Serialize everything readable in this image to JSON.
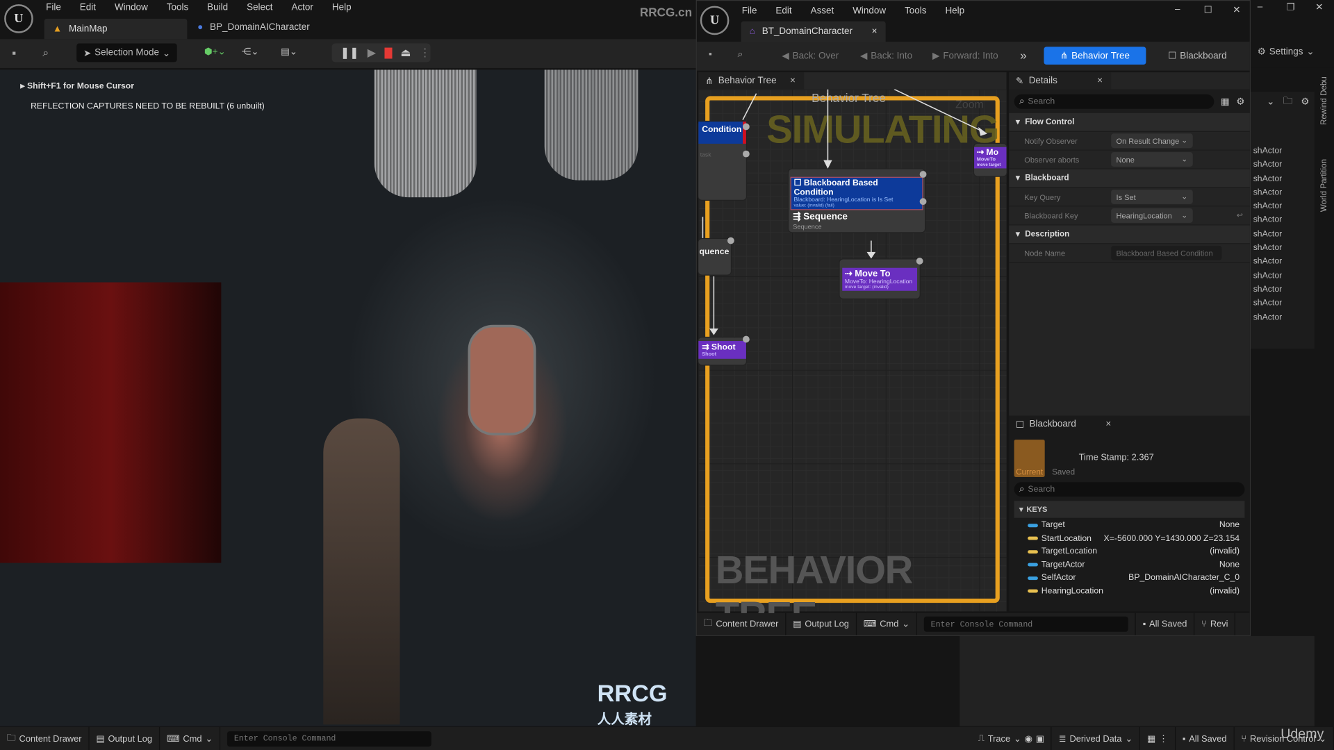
{
  "main_editor": {
    "menu": [
      "File",
      "Edit",
      "Window",
      "Tools",
      "Build",
      "Select",
      "Actor",
      "Help"
    ],
    "tabs": [
      {
        "label": "MainMap",
        "icon": "level-icon"
      },
      {
        "label": "BP_DomainAICharacter",
        "icon": "character-icon"
      }
    ],
    "toolbar": {
      "selection_mode": "Selection Mode"
    },
    "viewport": {
      "hint": "Shift+F1 for Mouse Cursor",
      "warning": "REFLECTION CAPTURES NEED TO BE REBUILT (6 unbuilt)"
    },
    "statusbar": {
      "content_drawer": "Content Drawer",
      "output_log": "Output Log",
      "cmd": "Cmd",
      "console_placeholder": "Enter Console Command",
      "trace": "Trace",
      "derived_data": "Derived Data",
      "all_saved": "All Saved",
      "revision_control": "Revision Control"
    }
  },
  "watermark": {
    "top": "RRCG.cn",
    "logo_text": "RRCG",
    "logo_sub": "人人素材",
    "udemy": "Udemy"
  },
  "bt_editor": {
    "menu": [
      "File",
      "Edit",
      "Asset",
      "Window",
      "Tools",
      "Help"
    ],
    "tab": "BT_DomainCharacter",
    "toolbar": {
      "back_over": "Back: Over",
      "back_into": "Back: Into",
      "forward_into": "Forward: Into",
      "behavior_tree": "Behavior Tree",
      "blackboard": "Blackboard",
      "settings": "Settings"
    },
    "graph": {
      "tab": "Behavior Tree",
      "title": "Behavior Tree",
      "zoom": "Zoom",
      "simulating": "SIMULATING",
      "watermark": "BEHAVIOR TREE",
      "nodes": {
        "left_condition": "Condition",
        "left_task": "task",
        "left_sequence": "quence",
        "left_shoot": "Shoot",
        "left_shoot_sub": "Shoot",
        "decorator_title": "Blackboard Based Condition",
        "decorator_line1": "Blackboard: HearingLocation is Is Set",
        "decorator_line2": "value: (invalid) (fail)",
        "sequence_title": "Sequence",
        "sequence_sub": "Sequence",
        "moveto_title": "Move To",
        "moveto_line1": "MoveTo: HearingLocation",
        "moveto_line2": "move target: (invalid)",
        "right_moveto": "Mo",
        "right_moveto_l1": "MoveTo",
        "right_moveto_l2": "move target"
      }
    },
    "details": {
      "tab": "Details",
      "search_placeholder": "Search",
      "categories": [
        {
          "name": "Flow Control",
          "rows": [
            {
              "label": "Notify Observer",
              "value": "On Result Change"
            },
            {
              "label": "Observer aborts",
              "value": "None"
            }
          ]
        },
        {
          "name": "Blackboard",
          "rows": [
            {
              "label": "Key Query",
              "value": "Is Set"
            },
            {
              "label": "Blackboard Key",
              "value": "HearingLocation"
            }
          ]
        },
        {
          "name": "Description",
          "rows": [
            {
              "label": "Node Name",
              "value": "Blackboard Based Condition"
            }
          ]
        }
      ]
    },
    "blackboard": {
      "tab": "Blackboard",
      "current": "Current",
      "saved": "Saved",
      "timestamp": "Time Stamp: 2.367",
      "search_placeholder": "Search",
      "keys_header": "KEYS",
      "keys": [
        {
          "name": "Target",
          "value": "None",
          "color": "#3aa0e0"
        },
        {
          "name": "StartLocation",
          "value": "X=-5600.000 Y=1430.000 Z=23.154",
          "color": "#e8c050"
        },
        {
          "name": "TargetLocation",
          "value": "(invalid)",
          "color": "#e8c050"
        },
        {
          "name": "TargetActor",
          "value": "None",
          "color": "#3aa0e0"
        },
        {
          "name": "SelfActor",
          "value": "BP_DomainAICharacter_C_0",
          "color": "#3aa0e0"
        },
        {
          "name": "HearingLocation",
          "value": "(invalid)",
          "color": "#e8c050"
        }
      ]
    },
    "statusbar": {
      "content_drawer": "Content Drawer",
      "output_log": "Output Log",
      "cmd": "Cmd",
      "console_placeholder": "Enter Console Command",
      "all_saved": "All Saved",
      "revision": "Revi"
    }
  },
  "right_strip": {
    "items": [
      "shActor",
      "shActor",
      "shActor",
      "shActor",
      "shActor",
      "shActor",
      "shActor",
      "shActor",
      "shActor",
      "shActor",
      "shActor",
      "shActor",
      "shActor"
    ],
    "vertical_tabs": [
      "Rewind Debu",
      "World Partition"
    ]
  },
  "colors": {
    "accent": "#1a73e8",
    "simulating_frame": "#e8a020",
    "decorator": "#0d3a9a",
    "task": "#6a2fc0",
    "stop": "#e53935"
  }
}
